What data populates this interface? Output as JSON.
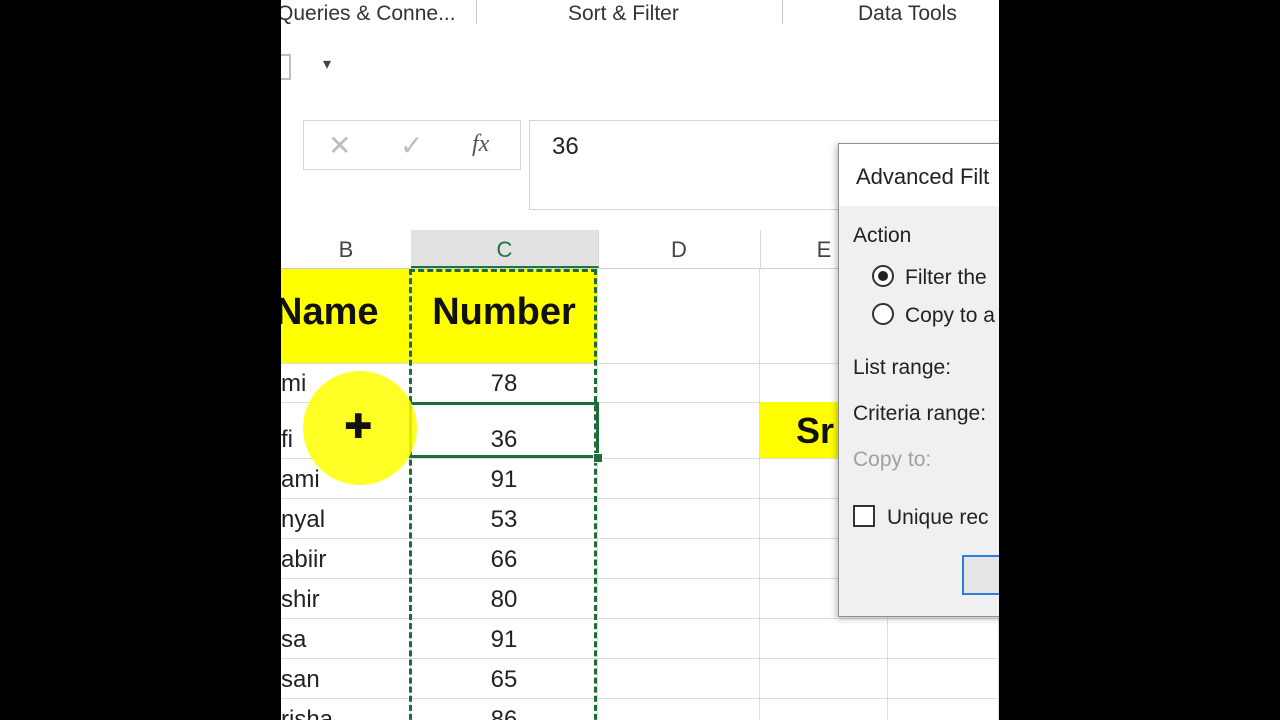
{
  "ribbon": {
    "groups": [
      "Queries & Conne...",
      "Sort & Filter",
      "Data Tools"
    ]
  },
  "formula_bar": {
    "cancel_icon": "✕",
    "enter_icon": "✓",
    "fx_label": "fx",
    "value": "36"
  },
  "columns": [
    "B",
    "C",
    "D",
    "E"
  ],
  "sheet": {
    "header": {
      "name": "Name",
      "number": "Number"
    },
    "rows": [
      {
        "name": "mi",
        "number": "78"
      },
      {
        "name": "fi",
        "number": "36"
      },
      {
        "name": "ami",
        "number": "91"
      },
      {
        "name": "nyal",
        "number": "53"
      },
      {
        "name": "abiir",
        "number": "66"
      },
      {
        "name": "shir",
        "number": "80"
      },
      {
        "name": "sa",
        "number": "91"
      },
      {
        "name": "san",
        "number": "65"
      },
      {
        "name": "risha",
        "number": "86"
      }
    ],
    "e_label": "Sr"
  },
  "dialog": {
    "title": "Advanced Filt",
    "action_label": "Action",
    "option_filter": "Filter the",
    "option_copy": "Copy to a",
    "list_range_label": "List range:",
    "criteria_range_label": "Criteria range:",
    "copy_to_label": "Copy to:",
    "unique_label": "Unique rec"
  },
  "colors": {
    "highlight": "#ffff00",
    "selection": "#1e6b3a",
    "ok_border": "#2b7de0"
  }
}
